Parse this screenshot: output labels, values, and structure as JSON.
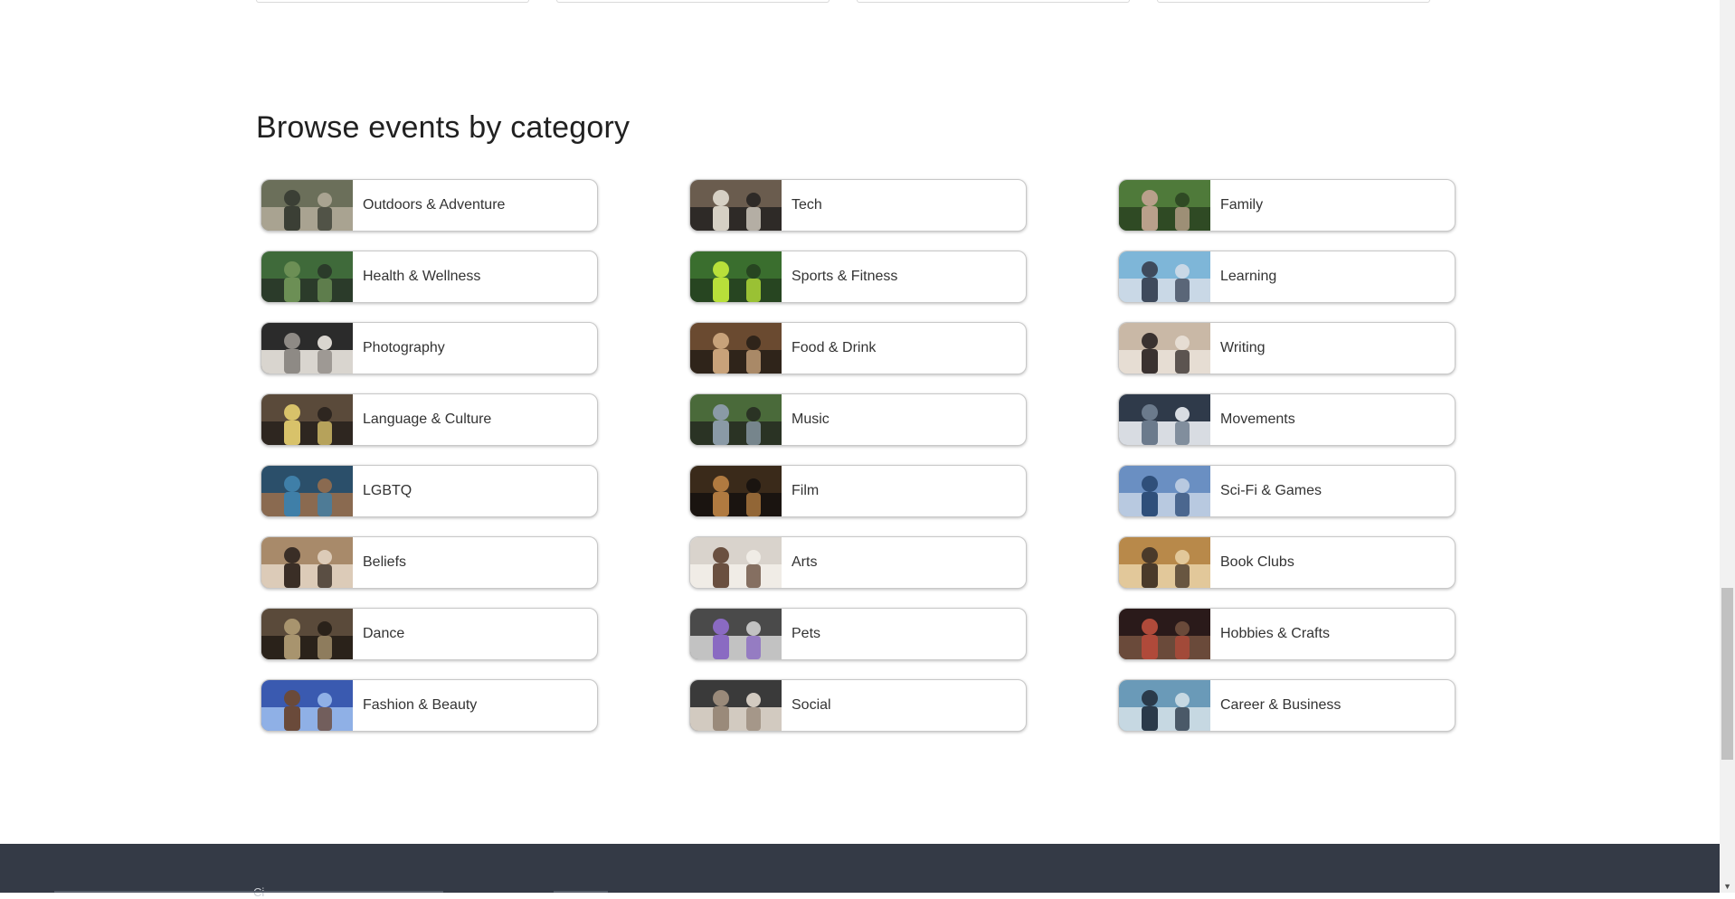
{
  "section": {
    "title": "Browse events by category"
  },
  "categories": [
    {
      "label": "Outdoors & Adventure",
      "icon": "outdoors-adventure-thumbnail",
      "colors": [
        "#6b6f5a",
        "#3b3f35",
        "#a9a391"
      ]
    },
    {
      "label": "Tech",
      "icon": "tech-thumbnail",
      "colors": [
        "#6a5c4e",
        "#d6d0c4",
        "#2e2a27"
      ]
    },
    {
      "label": "Family",
      "icon": "family-thumbnail",
      "colors": [
        "#4f7a3a",
        "#b9a08b",
        "#2f4a24"
      ]
    },
    {
      "label": "Health & Wellness",
      "icon": "health-wellness-thumbnail",
      "colors": [
        "#3f6a3a",
        "#6c8f55",
        "#2b3b2a"
      ]
    },
    {
      "label": "Sports & Fitness",
      "icon": "sports-fitness-thumbnail",
      "colors": [
        "#3a6e2e",
        "#b8e03a",
        "#274521"
      ]
    },
    {
      "label": "Learning",
      "icon": "learning-thumbnail",
      "colors": [
        "#7eb6d8",
        "#3e4a5c",
        "#c9d8e6"
      ]
    },
    {
      "label": "Photography",
      "icon": "photography-thumbnail",
      "colors": [
        "#2b2b2b",
        "#8e8a85",
        "#d9d5cf"
      ]
    },
    {
      "label": "Food & Drink",
      "icon": "food-drink-thumbnail",
      "colors": [
        "#6a4a30",
        "#c8a27a",
        "#2f241a"
      ]
    },
    {
      "label": "Writing",
      "icon": "writing-thumbnail",
      "colors": [
        "#c9b8a6",
        "#3a3230",
        "#e6ddd3"
      ]
    },
    {
      "label": "Language & Culture",
      "icon": "language-culture-thumbnail",
      "colors": [
        "#5a4a3a",
        "#d8c26a",
        "#2e2620"
      ]
    },
    {
      "label": "Music",
      "icon": "music-thumbnail",
      "colors": [
        "#4a6a3a",
        "#8a9aa6",
        "#2a3324"
      ]
    },
    {
      "label": "Movements",
      "icon": "movements-thumbnail",
      "colors": [
        "#2f3a4a",
        "#6b7a8c",
        "#d8dce2"
      ]
    },
    {
      "label": "LGBTQ",
      "icon": "lgbtq-thumbnail",
      "colors": [
        "#2b4f6a",
        "#3f7fa8",
        "#8a6a50"
      ]
    },
    {
      "label": "Film",
      "icon": "film-thumbnail",
      "colors": [
        "#3a2a1a",
        "#b07a40",
        "#1a1410"
      ]
    },
    {
      "label": "Sci-Fi & Games",
      "icon": "scifi-games-thumbnail",
      "colors": [
        "#6a8fc2",
        "#2f4f7a",
        "#b8c9e0"
      ]
    },
    {
      "label": "Beliefs",
      "icon": "beliefs-thumbnail",
      "colors": [
        "#a88a6a",
        "#3a2e26",
        "#dccbb8"
      ]
    },
    {
      "label": "Arts",
      "icon": "arts-thumbnail",
      "colors": [
        "#d9d3cc",
        "#6a5040",
        "#f0ece6"
      ]
    },
    {
      "label": "Book Clubs",
      "icon": "book-clubs-thumbnail",
      "colors": [
        "#b8894a",
        "#4a3a2a",
        "#e2c89a"
      ]
    },
    {
      "label": "Dance",
      "icon": "dance-thumbnail",
      "colors": [
        "#5a4a3a",
        "#a8946e",
        "#2a221a"
      ]
    },
    {
      "label": "Pets",
      "icon": "pets-thumbnail",
      "colors": [
        "#4a4a4a",
        "#8a6ac2",
        "#c2c2c2"
      ]
    },
    {
      "label": "Hobbies & Crafts",
      "icon": "hobbies-crafts-thumbnail",
      "colors": [
        "#2a1a1a",
        "#b04a3a",
        "#6a4a3a"
      ]
    },
    {
      "label": "Fashion & Beauty",
      "icon": "fashion-beauty-thumbnail",
      "colors": [
        "#3a5ab0",
        "#6a4a3a",
        "#8fb0e6"
      ]
    },
    {
      "label": "Social",
      "icon": "social-thumbnail",
      "colors": [
        "#3a3a3a",
        "#9a8a7a",
        "#d2cac0"
      ]
    },
    {
      "label": "Career & Business",
      "icon": "career-business-thumbnail",
      "colors": [
        "#6a9ab8",
        "#2a3a4a",
        "#c6d8e2"
      ]
    }
  ],
  "footer": {
    "text": "Ci"
  },
  "colors": {
    "footer_bg": "#343a46",
    "card_border": "#c8c8c8",
    "text": "#333333"
  }
}
